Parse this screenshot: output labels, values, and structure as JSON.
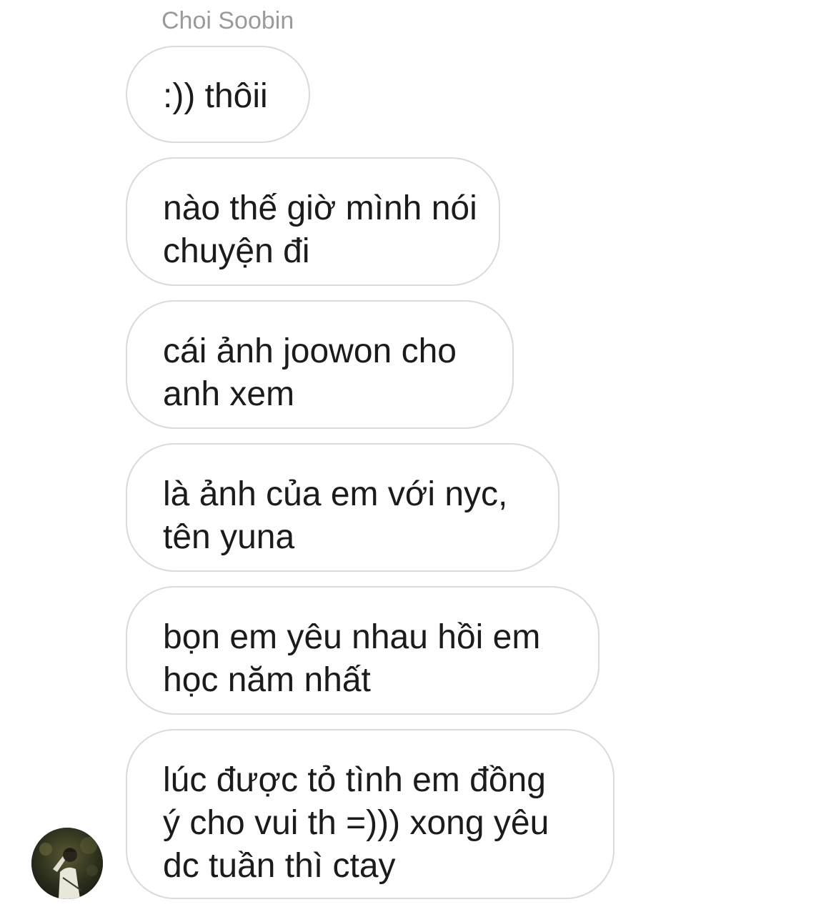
{
  "thread": {
    "sender_name": "Choi Soobin"
  },
  "messages": [
    {
      "text": ":)) thôii"
    },
    {
      "text": "nào thế giờ mình nói\nchuyện đi"
    },
    {
      "text": "cái ảnh joowon cho\nanh xem"
    },
    {
      "text": "là ảnh của em với nyc,\ntên yuna"
    },
    {
      "text": "bọn em yêu nhau hồi em\nhọc năm nhất"
    },
    {
      "text": "lúc được tỏ tình em đồng\ný cho vui th =))) xong yêu\ndc tuần thì ctay"
    }
  ],
  "avatar": {
    "icon": "profile-photo"
  },
  "colors": {
    "bubble_border": "#dadada",
    "text": "#1b1b1b",
    "sender_name": "#9a9a9a"
  }
}
